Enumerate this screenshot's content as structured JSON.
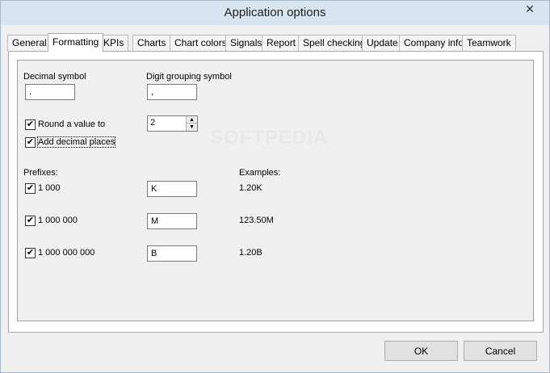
{
  "window": {
    "title": "Application options"
  },
  "tabs": [
    {
      "label": "General"
    },
    {
      "label": "Formatting"
    },
    {
      "label": "KPIs"
    },
    {
      "label": "Charts"
    },
    {
      "label": "Chart colors"
    },
    {
      "label": "Signals"
    },
    {
      "label": "Report"
    },
    {
      "label": "Spell checking"
    },
    {
      "label": "Update"
    },
    {
      "label": "Company info"
    },
    {
      "label": "Teamwork"
    }
  ],
  "formatting": {
    "decimal_symbol_label": "Decimal symbol",
    "decimal_symbol_value": ".",
    "digit_grouping_label": "Digit grouping symbol",
    "digit_grouping_value": ",",
    "round_label": "Round a value to",
    "round_checked": true,
    "round_value": "2",
    "add_decimal_label": "Add decimal places",
    "add_decimal_checked": true,
    "prefixes_label": "Prefixes:",
    "examples_label": "Examples:",
    "prefixes": [
      {
        "label": "1 000",
        "checked": true,
        "value": "K",
        "example": "1.20K"
      },
      {
        "label": "1 000 000",
        "checked": true,
        "value": "M",
        "example": "123.50M"
      },
      {
        "label": "1 000 000 000",
        "checked": true,
        "value": "B",
        "example": "1.20B"
      }
    ]
  },
  "buttons": {
    "ok": "OK",
    "cancel": "Cancel"
  },
  "watermark": "SOFTPEDIA",
  "check_mark": "✔",
  "close_glyph": "✕",
  "spin_up_glyph": "▲",
  "spin_down_glyph": "▼"
}
